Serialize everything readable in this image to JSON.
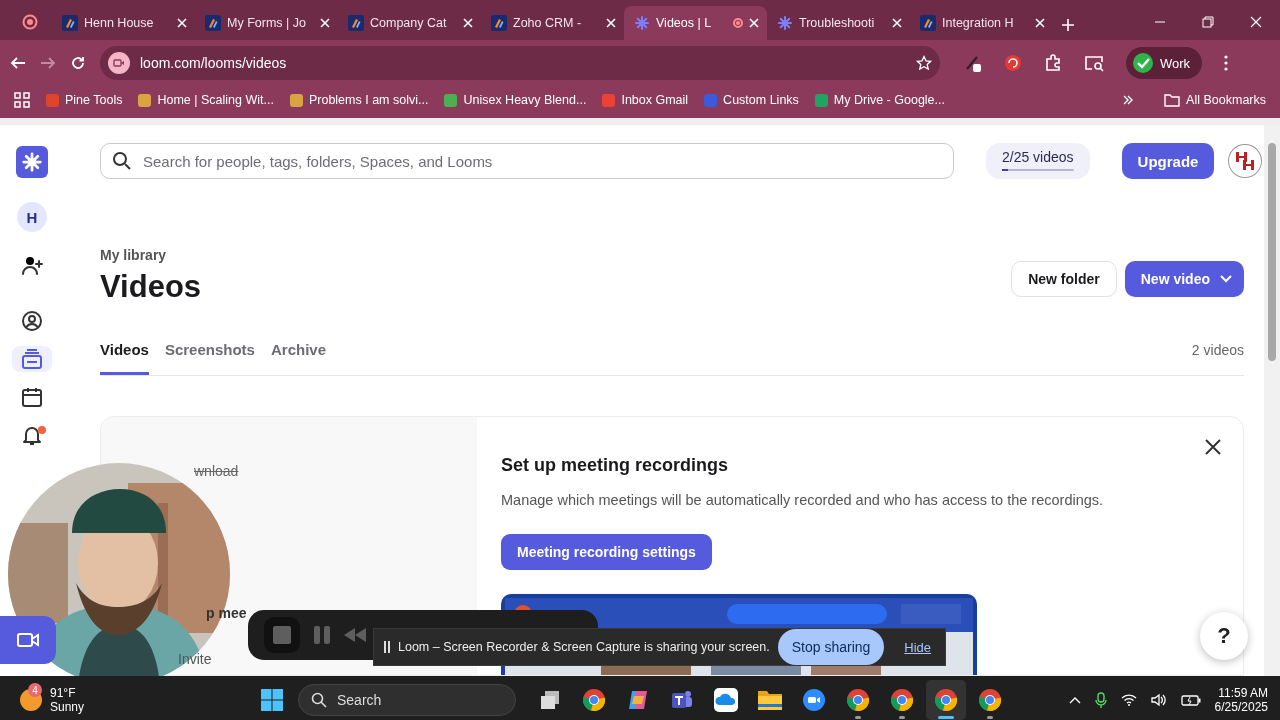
{
  "tabs": [
    {
      "title": "Henn House",
      "kind": "forms",
      "selected": false,
      "recording": false
    },
    {
      "title": "My Forms | Jo",
      "kind": "forms",
      "selected": false,
      "recording": false
    },
    {
      "title": "Company Cat",
      "kind": "forms",
      "selected": false,
      "recording": false
    },
    {
      "title": "Zoho CRM -",
      "kind": "forms",
      "selected": false,
      "recording": false
    },
    {
      "title": "Videos | L",
      "kind": "loom",
      "selected": true,
      "recording": true
    },
    {
      "title": "Troubleshooti",
      "kind": "loom",
      "selected": false,
      "recording": false
    },
    {
      "title": "Integration H",
      "kind": "forms",
      "selected": false,
      "recording": false
    }
  ],
  "address_bar": {
    "url": "loom.com/looms/videos"
  },
  "profile": {
    "label": "Work"
  },
  "bookmarks": [
    {
      "label": "Pine Tools",
      "color": "#e0442c"
    },
    {
      "label": "Home | Scaling Wit...",
      "color": "#d9a441"
    },
    {
      "label": "Problems I am solvi...",
      "color": "#d9a441"
    },
    {
      "label": "Unisex Heavy Blend...",
      "color": "#4caf50"
    },
    {
      "label": "Inbox Gmail",
      "color": "#ea4335"
    },
    {
      "label": "Custom Links",
      "color": "#3b5bdb"
    },
    {
      "label": "My Drive - Google...",
      "color": "#1fa463"
    }
  ],
  "all_bookmarks": "All Bookmarks",
  "sidebar": {
    "workspace": "H",
    "items": [
      {
        "kind": "add-person",
        "selected": false
      },
      {
        "kind": "user",
        "selected": false
      },
      {
        "kind": "library",
        "selected": true
      },
      {
        "kind": "calendar",
        "selected": false
      },
      {
        "kind": "bell",
        "selected": false,
        "badge": true
      }
    ]
  },
  "search": {
    "placeholder": "Search for people, tags, folders, Spaces, and Looms"
  },
  "quota": {
    "label": "2/25 videos",
    "level": 0.08
  },
  "upgrade": "Upgrade",
  "breadcrumb": "My library",
  "title": "Videos",
  "actions": {
    "new_folder": "New folder",
    "new_video": "New video"
  },
  "content_tabs": [
    {
      "label": "Videos",
      "selected": true
    },
    {
      "label": "Screenshots",
      "selected": false
    },
    {
      "label": "Archive",
      "selected": false
    }
  ],
  "video_count": "2 videos",
  "card": {
    "left_texts": [
      "wnload",
      "p mee",
      "Invite"
    ],
    "title": "Set up meeting recordings",
    "description": "Manage which meetings will be automatically recorded and who has access to the recordings.",
    "button": "Meeting recording settings"
  },
  "share_notice": {
    "message": "Loom – Screen Recorder & Screen Capture is sharing your screen.",
    "stop": "Stop sharing",
    "hide": "Hide"
  },
  "help": "?",
  "taskbar": {
    "weather": {
      "temp": "91°F",
      "condition": "Sunny",
      "badge": "4"
    },
    "search": "Search",
    "apps": [
      {
        "kind": "taskview",
        "running": false,
        "selected": false
      },
      {
        "kind": "chrome",
        "running": false,
        "selected": false
      },
      {
        "kind": "copilot",
        "running": false,
        "selected": false
      },
      {
        "kind": "teams",
        "running": false,
        "selected": false
      },
      {
        "kind": "cloud",
        "running": false,
        "selected": false
      },
      {
        "kind": "folder",
        "running": false,
        "selected": false
      },
      {
        "kind": "zoom",
        "running": false,
        "selected": false
      },
      {
        "kind": "chrome",
        "running": true,
        "selected": false
      },
      {
        "kind": "chrome",
        "running": true,
        "selected": false
      },
      {
        "kind": "chrome",
        "running": true,
        "selected": true
      },
      {
        "kind": "chrome",
        "running": true,
        "selected": false
      }
    ],
    "time": "11:59 AM",
    "date": "6/25/2025"
  }
}
